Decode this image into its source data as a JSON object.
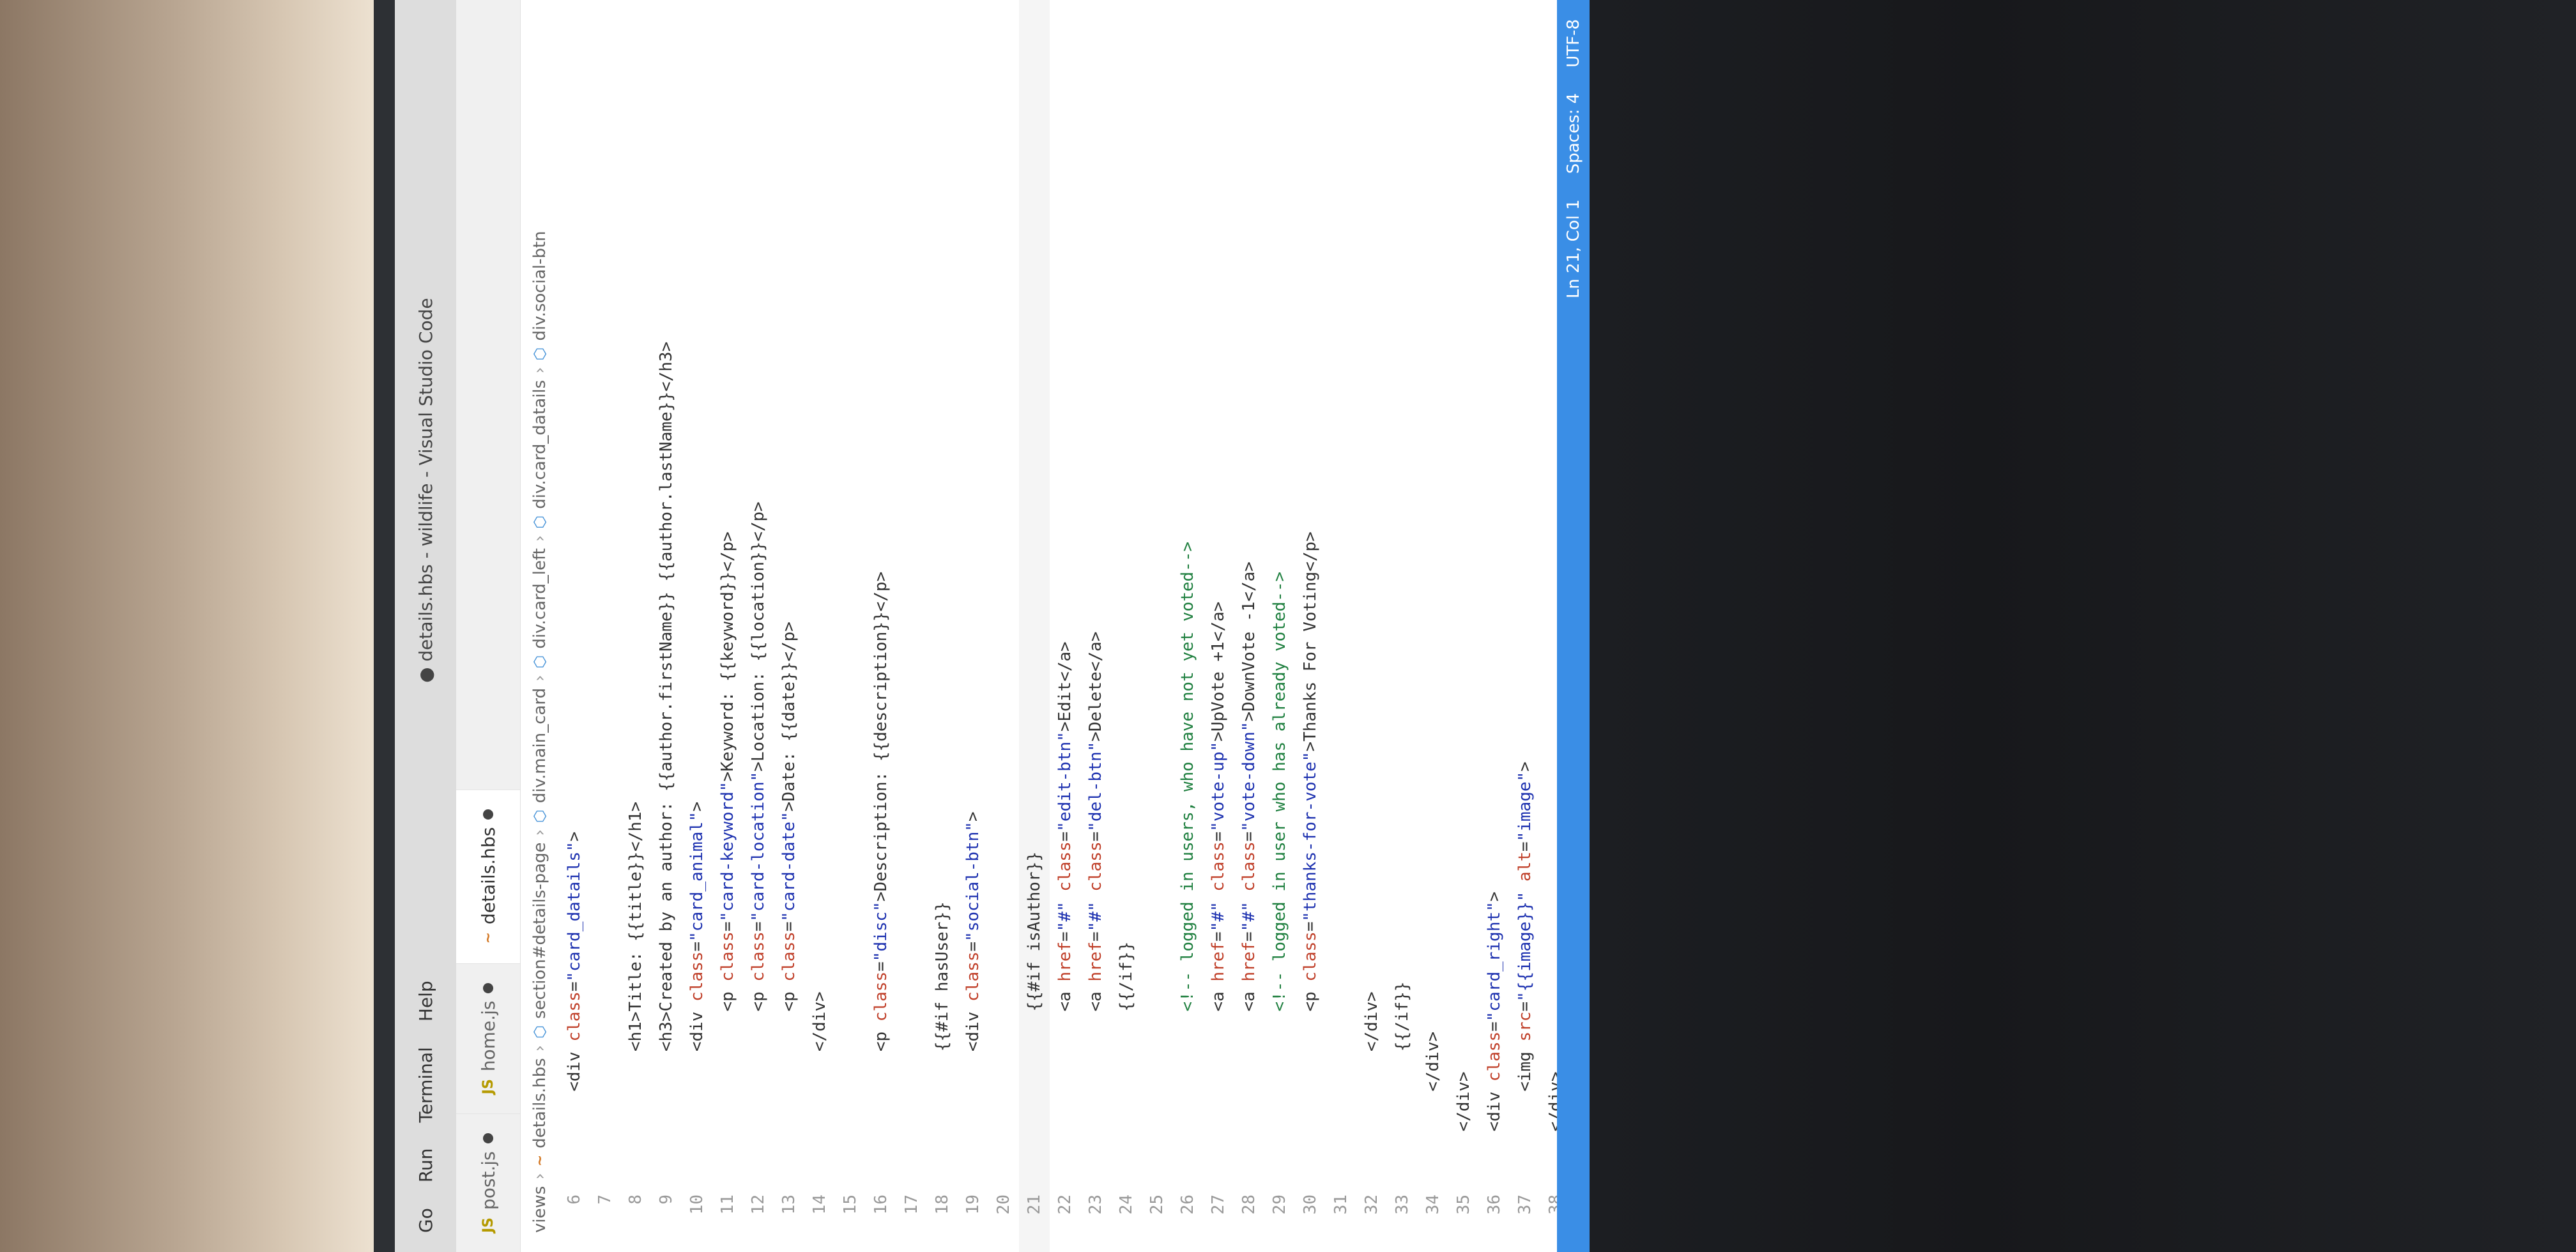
{
  "window": {
    "menu": [
      "Go",
      "Run",
      "Terminal",
      "Help"
    ],
    "title": "● details.hbs - wildlife - Visual Studio Code"
  },
  "tabs": [
    {
      "icon": "JS",
      "label": "post.js",
      "modified": true,
      "active": false
    },
    {
      "icon": "JS",
      "label": "home.js",
      "modified": true,
      "active": false
    },
    {
      "icon": "~",
      "label": "details.hbs",
      "modified": true,
      "active": true
    }
  ],
  "breadcrumbs": [
    "views",
    "details.hbs",
    "section#details-page",
    "div.main_card",
    "div.card_left",
    "div.card_datails",
    "div.social-btn"
  ],
  "editor": {
    "lines": [
      {
        "n": "6",
        "text": "        <div class=\"card_datails\">"
      },
      {
        "n": "7",
        "text": ""
      },
      {
        "n": "8",
        "text": "            <h1>Title: {{title}}</h1>"
      },
      {
        "n": "9",
        "text": "            <h3>Created by an author: {{author.firstName}} {{author.lastName}}</h3>"
      },
      {
        "n": "10",
        "text": "            <div class=\"card_animal\">"
      },
      {
        "n": "11",
        "text": "                <p class=\"card-keyword\">Keyword: {{keyword}}</p>"
      },
      {
        "n": "12",
        "text": "                <p class=\"card-location\">Location: {{location}}</p>"
      },
      {
        "n": "13",
        "text": "                <p class=\"card-date\">Date: {{date}}</p>"
      },
      {
        "n": "14",
        "text": "            </div>"
      },
      {
        "n": "15",
        "text": ""
      },
      {
        "n": "16",
        "text": "            <p class=\"disc\">Description: {{description}}</p>"
      },
      {
        "n": "17",
        "text": ""
      },
      {
        "n": "18",
        "text": "            {{#if hasUser}}"
      },
      {
        "n": "19",
        "text": "            <div class=\"social-btn\">"
      },
      {
        "n": "20",
        "text": ""
      },
      {
        "n": "21",
        "text": "                {{#if isAuthor}}"
      },
      {
        "n": "22",
        "text": "                <a href=\"#\" class=\"edit-btn\">Edit</a>"
      },
      {
        "n": "23",
        "text": "                <a href=\"#\" class=\"del-btn\">Delete</a>"
      },
      {
        "n": "24",
        "text": "                {{/if}}"
      },
      {
        "n": "25",
        "text": ""
      },
      {
        "n": "26",
        "text": "                <!-- logged in users, who have not yet voted-->"
      },
      {
        "n": "27",
        "text": "                <a href=\"#\" class=\"vote-up\">UpVote +1</a>"
      },
      {
        "n": "28",
        "text": "                <a href=\"#\" class=\"vote-down\">DownVote -1</a>"
      },
      {
        "n": "29",
        "text": "                <!-- logged in user who has already voted-->"
      },
      {
        "n": "30",
        "text": "                <p class=\"thanks-for-vote\">Thanks For Voting</p>"
      },
      {
        "n": "31",
        "text": ""
      },
      {
        "n": "32",
        "text": "            </div>"
      },
      {
        "n": "33",
        "text": "            {{/if}}"
      },
      {
        "n": "34",
        "text": "        </div>"
      },
      {
        "n": "35",
        "text": "    </div>"
      },
      {
        "n": "36",
        "text": "    <div class=\"card_right\">"
      },
      {
        "n": "37",
        "text": "        <img src=\"{{image}}\" alt=\"image\">"
      },
      {
        "n": "38",
        "text": "    </div>"
      }
    ],
    "current_line": "21"
  },
  "statusbar": {
    "position": "Ln 21, Col 1",
    "spaces": "Spaces: 4",
    "encoding": "UTF-8"
  }
}
